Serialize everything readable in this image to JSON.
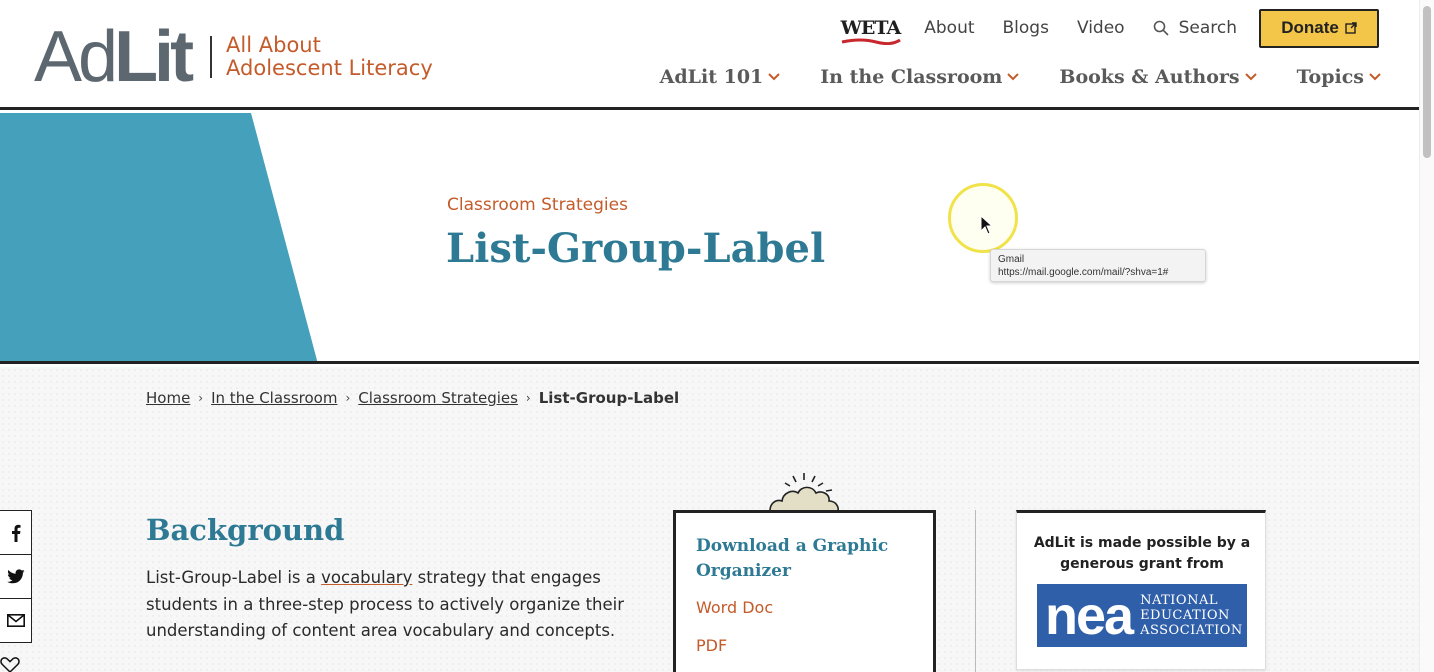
{
  "logo": {
    "ad": "Ad",
    "lit": "Lit",
    "tagline_1": "All About",
    "tagline_2": "Adolescent Literacy"
  },
  "utility_nav": {
    "weta": "WETA",
    "about": "About",
    "blogs": "Blogs",
    "video": "Video",
    "search": "Search",
    "donate": "Donate"
  },
  "main_nav": [
    {
      "label": "AdLit 101"
    },
    {
      "label": "In the Classroom"
    },
    {
      "label": "Books & Authors"
    },
    {
      "label": "Topics"
    }
  ],
  "hero": {
    "kicker": "Classroom Strategies",
    "title": "List-Group-Label"
  },
  "tooltip": {
    "title": "Gmail",
    "url": "https://mail.google.com/mail/?shva=1#"
  },
  "breadcrumb": {
    "home": "Home",
    "classroom": "In the Classroom",
    "strategies": "Classroom Strategies",
    "current": "List-Group-Label"
  },
  "background": {
    "heading": "Background",
    "text_before": "List-Group-Label is a ",
    "link": "vocabulary",
    "text_after": " strategy that engages students in a three-step process to actively organize their understanding of content area vocabulary and concepts."
  },
  "organizer": {
    "title": "Download a Graphic Organizer",
    "word_doc": "Word Doc",
    "pdf": "PDF"
  },
  "sponsor": {
    "text": "AdLit is made possible by a generous grant from",
    "nea_mark": "nea",
    "nea_line1": "NATIONAL",
    "nea_line2": "EDUCATION",
    "nea_line3": "ASSOCIATION"
  },
  "colors": {
    "accent_teal": "#2e7a94",
    "hero_shape": "#44a0bb",
    "accent_orange": "#c45b2b",
    "donate_yellow": "#f3c548",
    "nea_blue": "#2f5fa8"
  }
}
